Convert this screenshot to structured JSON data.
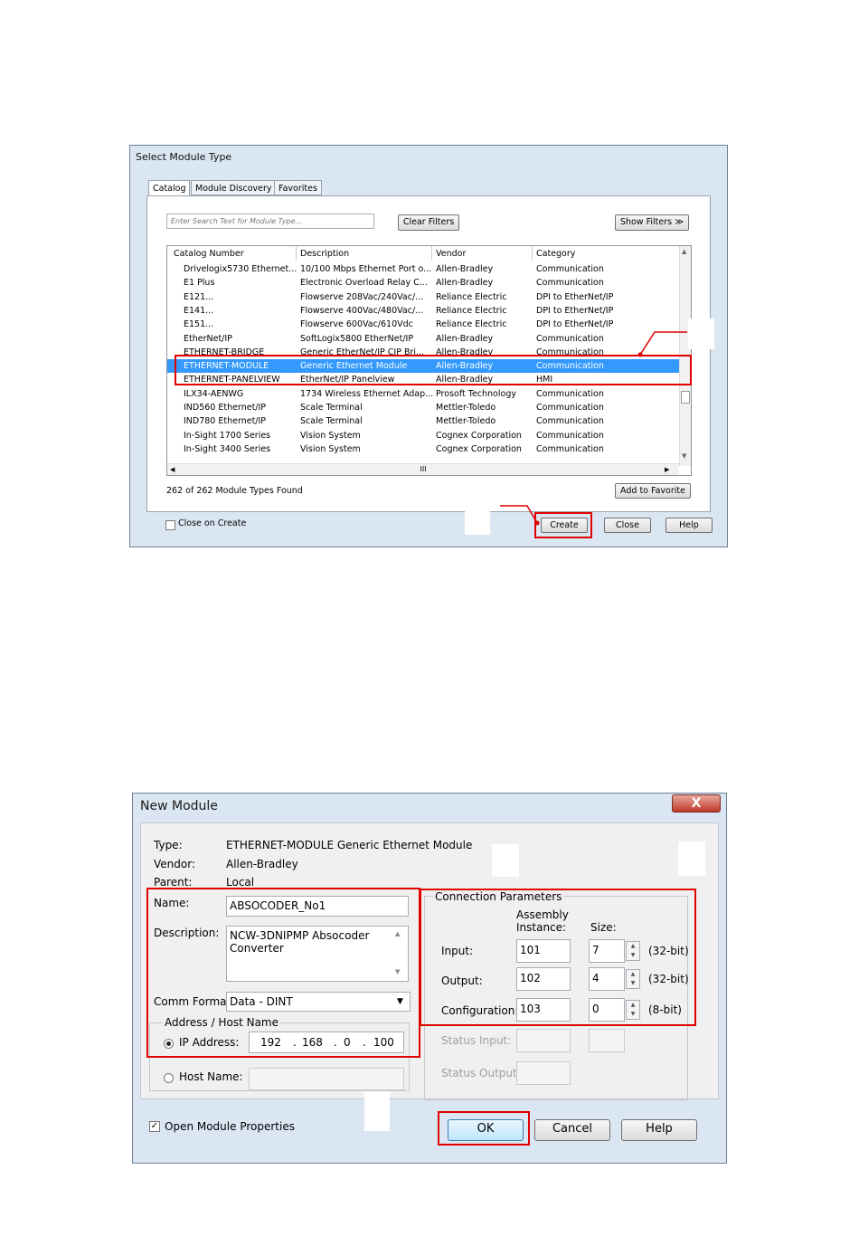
{
  "select_module": {
    "title": "Select Module Type",
    "tabs": [
      "Catalog",
      "Module Discovery",
      "Favorites"
    ],
    "search_placeholder": "Enter Search Text for Module Type...",
    "clear_filters": "Clear Filters",
    "show_filters": "Show Filters ≫",
    "columns": [
      "Catalog Number",
      "Description",
      "Vendor",
      "Category"
    ],
    "rows": [
      [
        "Drivelogix5730 Ethernet...",
        "10/100 Mbps Ethernet Port o...",
        "Allen-Bradley",
        "Communication"
      ],
      [
        "E1 Plus",
        "Electronic Overload Relay C...",
        "Allen-Bradley",
        "Communication"
      ],
      [
        "E121...",
        "Flowserve 208Vac/240Vac/...",
        "Reliance Electric",
        "DPI to EtherNet/IP"
      ],
      [
        "E141...",
        "Flowserve 400Vac/480Vac/...",
        "Reliance Electric",
        "DPI to EtherNet/IP"
      ],
      [
        "E151...",
        "Flowserve 600Vac/610Vdc",
        "Reliance Electric",
        "DPI to EtherNet/IP"
      ],
      [
        "EtherNet/IP",
        "SoftLogix5800 EtherNet/IP",
        "Allen-Bradley",
        "Communication"
      ],
      [
        "ETHERNET-BRIDGE",
        "Generic EtherNet/IP CIP Bri...",
        "Allen-Bradley",
        "Communication"
      ],
      [
        "ETHERNET-MODULE",
        "Generic Ethernet Module",
        "Allen-Bradley",
        "Communication"
      ],
      [
        "ETHERNET-PANELVIEW",
        "EtherNet/IP Panelview",
        "Allen-Bradley",
        "HMI"
      ],
      [
        "ILX34-AENWG",
        "1734 Wireless Ethernet Adap...",
        "Prosoft Technology",
        "Communication"
      ],
      [
        "IND560 Ethernet/IP",
        "Scale Terminal",
        "Mettler-Toledo",
        "Communication"
      ],
      [
        "IND780 Ethernet/IP",
        "Scale Terminal",
        "Mettler-Toledo",
        "Communication"
      ],
      [
        "In-Sight 1700 Series",
        "Vision System",
        "Cognex Corporation",
        "Communication"
      ],
      [
        "In-Sight 3400 Series",
        "Vision System",
        "Cognex Corporation",
        "Communication"
      ]
    ],
    "selected_row": 7,
    "hscroll_label": "III",
    "found_text": "262  of 262 Module Types Found",
    "add_favorite": "Add to Favorite",
    "close_on_create": "Close on Create",
    "create": "Create",
    "close": "Close",
    "help": "Help"
  },
  "new_module": {
    "title": "New Module",
    "close_x": "X",
    "type_label": "Type:",
    "type_value": "ETHERNET-MODULE Generic Ethernet Module",
    "vendor_label": "Vendor:",
    "vendor_value": "Allen-Bradley",
    "parent_label": "Parent:",
    "parent_value": "Local",
    "name_label": "Name:",
    "name_value": "ABSOCODER_No1",
    "description_label": "Description:",
    "description_line1": "NCW-3DNIPMP Absocoder",
    "description_line2": "Converter",
    "comm_format_label": "Comm Format:",
    "comm_format_value": "Data - DINT",
    "address_group": "Address / Host Name",
    "ip_label": "IP Address:",
    "ip": [
      "192",
      "168",
      "0",
      "100"
    ],
    "host_label": "Host Name:",
    "conn_params": "Connection Parameters",
    "assembly_instance": "Assembly Instance:",
    "size": "Size:",
    "input_label": "Input:",
    "input_instance": "101",
    "input_size": "7",
    "input_unit": "(32-bit)",
    "output_label": "Output:",
    "output_instance": "102",
    "output_size": "4",
    "output_unit": "(32-bit)",
    "config_label": "Configuration:",
    "config_instance": "103",
    "config_size": "0",
    "config_unit": "(8-bit)",
    "status_input": "Status Input:",
    "status_output": "Status Output:",
    "open_props": "Open Module Properties",
    "ok": "OK",
    "cancel": "Cancel",
    "help": "Help"
  }
}
